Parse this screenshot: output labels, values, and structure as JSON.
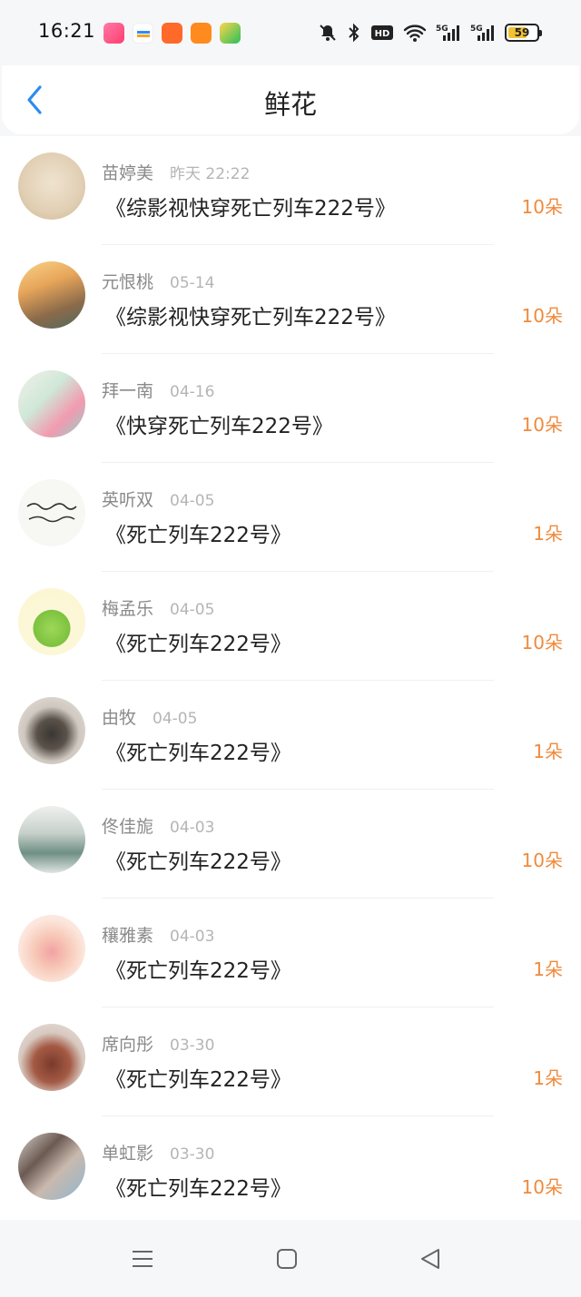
{
  "status_bar": {
    "time": "16:21",
    "battery": "59",
    "icons": [
      "bell-mute-icon",
      "bluetooth-icon",
      "hd-icon",
      "wifi-icon",
      "signal-5g-icon",
      "signal-5g-icon"
    ],
    "app_icons": [
      "app-pink",
      "app-blue",
      "app-orange",
      "app-orange-2",
      "app-green"
    ]
  },
  "header": {
    "title": "鲜花",
    "back_icon": "chevron-left-icon",
    "accent": "#2b8cf0"
  },
  "items": [
    {
      "name": "苗婷美",
      "time": "昨天 22:22",
      "title": "《综影视快穿死亡列车222号》",
      "count": "10朵"
    },
    {
      "name": "元恨桃",
      "time": "05-14",
      "title": "《综影视快穿死亡列车222号》",
      "count": "10朵"
    },
    {
      "name": "拜一南",
      "time": "04-16",
      "title": "《快穿死亡列车222号》",
      "count": "10朵"
    },
    {
      "name": "英听双",
      "time": "04-05",
      "title": "《死亡列车222号》",
      "count": "1朵"
    },
    {
      "name": "梅孟乐",
      "time": "04-05",
      "title": "《死亡列车222号》",
      "count": "10朵"
    },
    {
      "name": "由牧",
      "time": "04-05",
      "title": "《死亡列车222号》",
      "count": "1朵"
    },
    {
      "name": "佟佳旎",
      "time": "04-03",
      "title": "《死亡列车222号》",
      "count": "10朵"
    },
    {
      "name": "穰雅素",
      "time": "04-03",
      "title": "《死亡列车222号》",
      "count": "1朵"
    },
    {
      "name": "席向彤",
      "time": "03-30",
      "title": "《死亡列车222号》",
      "count": "1朵"
    },
    {
      "name": "单虹影",
      "time": "03-30",
      "title": "《死亡列车222号》",
      "count": "10朵"
    }
  ],
  "colors": {
    "count": "#f08a3c",
    "name": "#8a8a8a",
    "time": "#b5b5b5"
  },
  "nav": [
    "menu-icon",
    "home-square-icon",
    "back-triangle-icon"
  ]
}
